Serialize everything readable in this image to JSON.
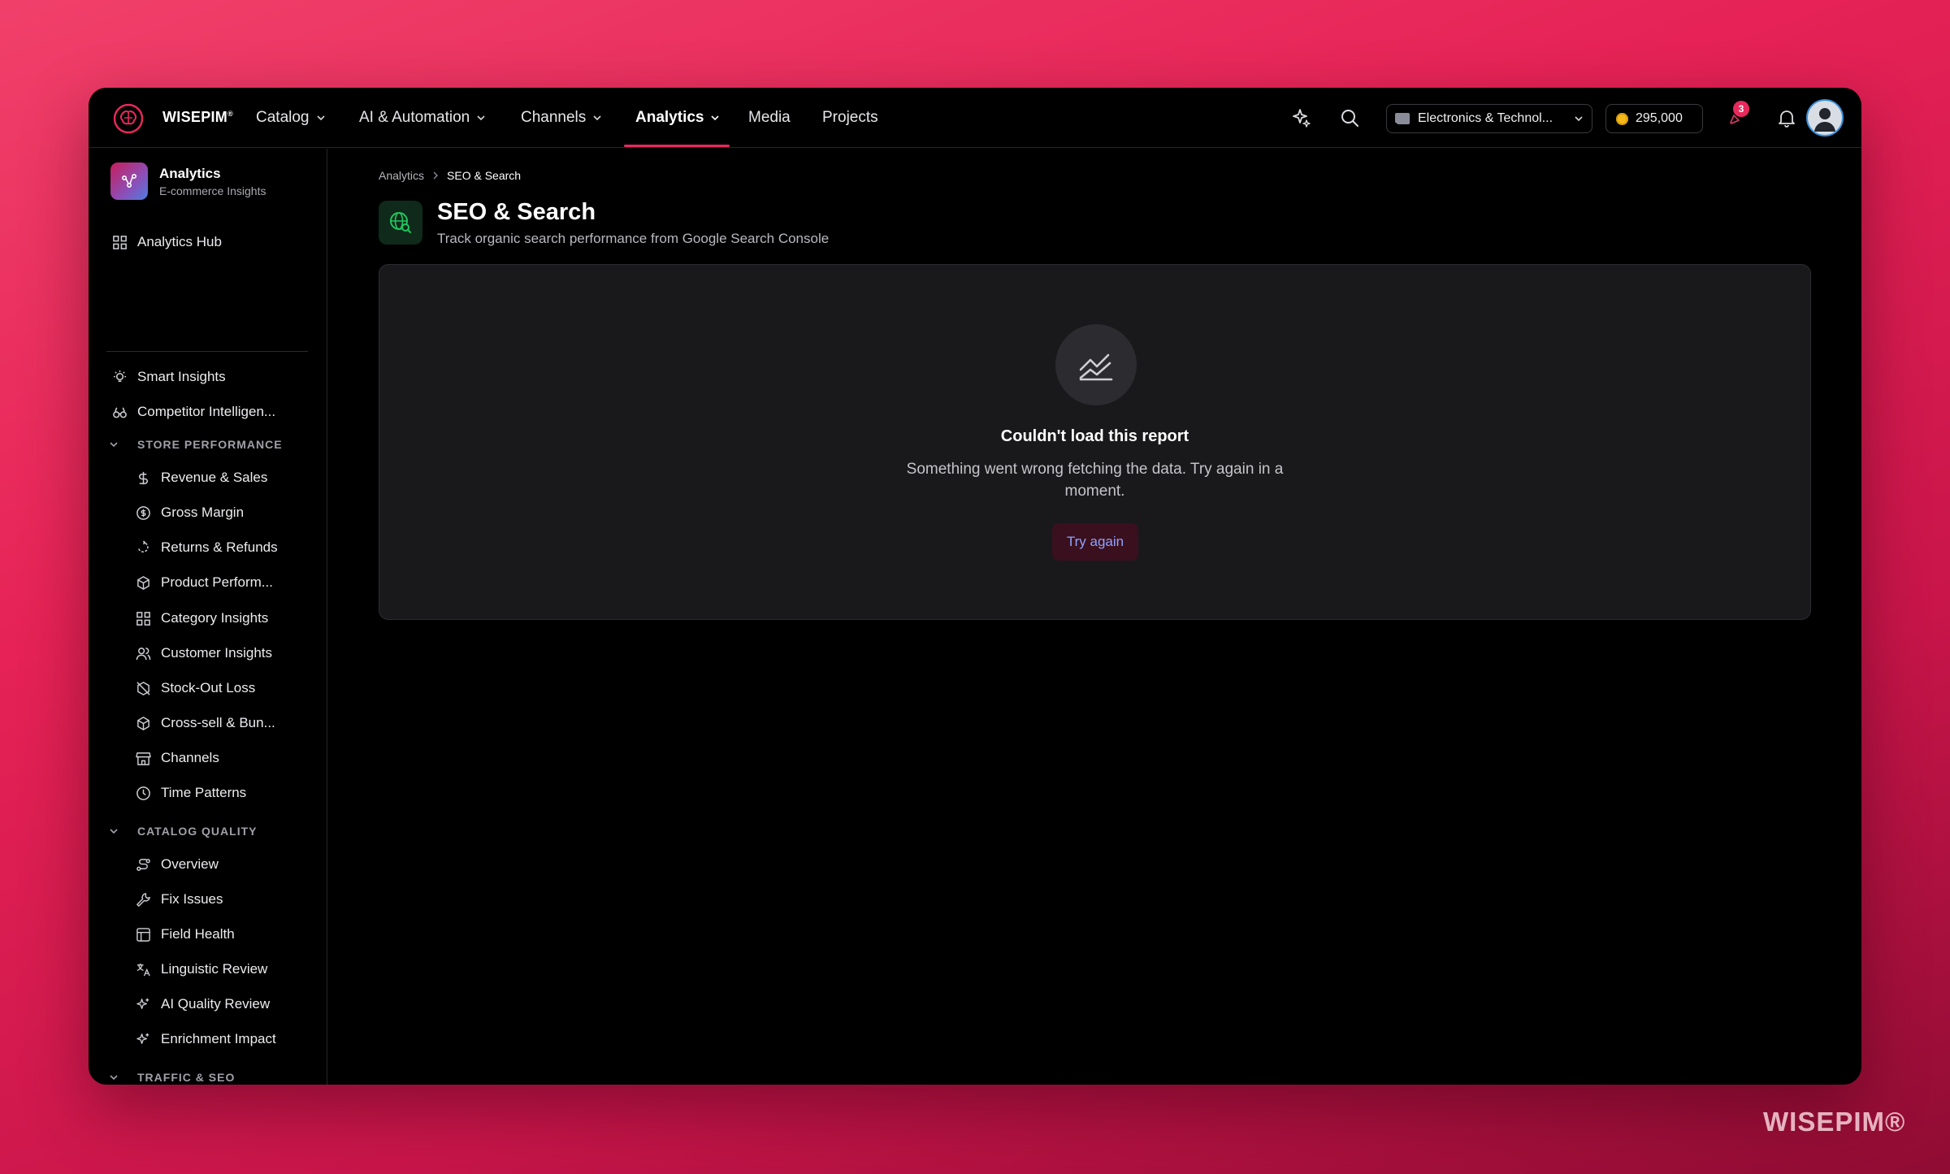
{
  "app": {
    "brand": "WISEPIM",
    "brand_mark": "®",
    "watermark": "WISEPIM®"
  },
  "topnav": {
    "items": [
      {
        "label": "Catalog",
        "has_dropdown": true
      },
      {
        "label": "AI & Automation",
        "has_dropdown": true
      },
      {
        "label": "Channels",
        "has_dropdown": true
      },
      {
        "label": "Analytics",
        "has_dropdown": true,
        "active": true
      },
      {
        "label": "Media",
        "has_dropdown": false
      },
      {
        "label": "Projects",
        "has_dropdown": false
      }
    ],
    "store_selector": "Electronics & Technol...",
    "credits": "295,000",
    "notification_badge": "3",
    "accent_color": "#e8295c"
  },
  "sidebar": {
    "title": "Analytics",
    "subtitle": "E-commerce Insights",
    "hub": "Analytics Hub",
    "top_items": [
      "Smart Insights",
      "Competitor Intelligen..."
    ],
    "sections": [
      {
        "label": "STORE PERFORMANCE",
        "items": [
          "Revenue & Sales",
          "Gross Margin",
          "Returns & Refunds",
          "Product Perform...",
          "Category Insights",
          "Customer Insights",
          "Stock-Out Loss",
          "Cross-sell & Bun...",
          "Channels",
          "Time Patterns"
        ]
      },
      {
        "label": "CATALOG QUALITY",
        "items": [
          "Overview",
          "Fix Issues",
          "Field Health",
          "Linguistic Review",
          "AI Quality Review",
          "Enrichment Impact"
        ]
      },
      {
        "label": "TRAFFIC & SEO",
        "items": []
      }
    ]
  },
  "main": {
    "breadcrumb": [
      "Analytics",
      "SEO & Search"
    ],
    "title": "SEO & Search",
    "subtitle": "Track organic search performance from Google Search Console",
    "error": {
      "title": "Couldn't load this report",
      "message": "Something went wrong fetching the data. Try again in a moment.",
      "button": "Try again"
    }
  }
}
